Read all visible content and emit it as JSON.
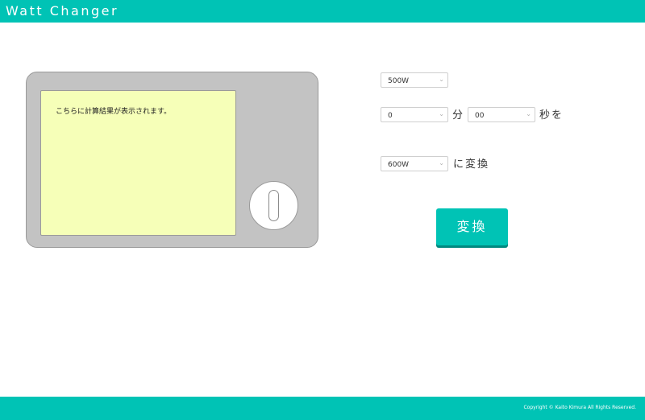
{
  "header": {
    "title": "Watt Changer"
  },
  "display": {
    "result_placeholder": "こちらに計算結果が表示されます。"
  },
  "form": {
    "source_watt": {
      "value": "500W"
    },
    "minutes": {
      "value": "0"
    },
    "minutes_unit": "分",
    "seconds": {
      "value": "00"
    },
    "seconds_unit": "秒を",
    "target_watt": {
      "value": "600W"
    },
    "target_suffix": "に変換",
    "convert_button": "変換"
  },
  "footer": {
    "copyright": "Copyright © Kaito Kimura All Rights Reserved."
  },
  "colors": {
    "accent": "#00c3b5",
    "screen": "#f6ffb8",
    "microwave_body": "#c3c3c3"
  },
  "icons": {
    "select_caret": "chevron-down-icon"
  }
}
